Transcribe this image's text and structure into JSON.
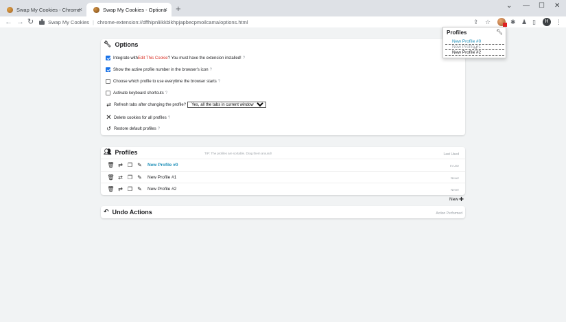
{
  "browser": {
    "tabs": [
      {
        "title": "Swap My Cookies - Chrome Web Store",
        "close": "×"
      },
      {
        "title": "Swap My Cookies - Options",
        "close": "×"
      }
    ],
    "new_tab": "+",
    "window_controls": {
      "dropdown": "⌄",
      "minimize": "—",
      "maximize": "☐",
      "close": "✕"
    },
    "nav": {
      "back": "←",
      "forward": "→",
      "reload": "↻"
    },
    "site_name": "Swap My Cookies",
    "url": "chrome-extension://dffhipnliikkblkhpjapbecpmoilcama/options.html",
    "avatar_letter": "H"
  },
  "options": {
    "title": "Options",
    "integrate": {
      "prefix": "Integrate with ",
      "link": "Edit This Cookie",
      "suffix": "? You must have the extension installed!",
      "checked": true
    },
    "show_active": {
      "label": "Show the active profile number in the browser's icon",
      "checked": true
    },
    "choose_profile": {
      "label": "Choose which profile to use everytime the browser starts",
      "checked": false
    },
    "keyboard": {
      "label": "Activate keyboard shortcuts",
      "checked": false
    },
    "refresh": {
      "label": "Refresh tabs after changing the profile?",
      "selected": "Yes, all the tabs in current window"
    },
    "delete_cookies": {
      "label": "Delete cookies for all profiles"
    },
    "restore": {
      "label": "Restore default profiles"
    },
    "help": "?"
  },
  "profiles": {
    "title": "Profiles",
    "tip": "TIP: The profiles are sortable. Drag them around!",
    "last_used_header": "Last Used",
    "rows": [
      {
        "name": "New Profile #0",
        "last_used": "In Use",
        "current": true
      },
      {
        "name": "New Profile #1",
        "last_used": "Never",
        "current": false
      },
      {
        "name": "New Profile #2",
        "last_used": "Never",
        "current": false
      }
    ],
    "new_label": "New",
    "new_plus": "+"
  },
  "undo": {
    "title": "Undo Actions",
    "header_right": "Action Performed"
  },
  "popup": {
    "title": "Profiles",
    "items": [
      {
        "name": "New Profile #0",
        "state": "current"
      },
      {
        "name": "New Profile #1",
        "state": "hovered"
      },
      {
        "name": "New Profile #2",
        "state": "normal"
      }
    ]
  }
}
